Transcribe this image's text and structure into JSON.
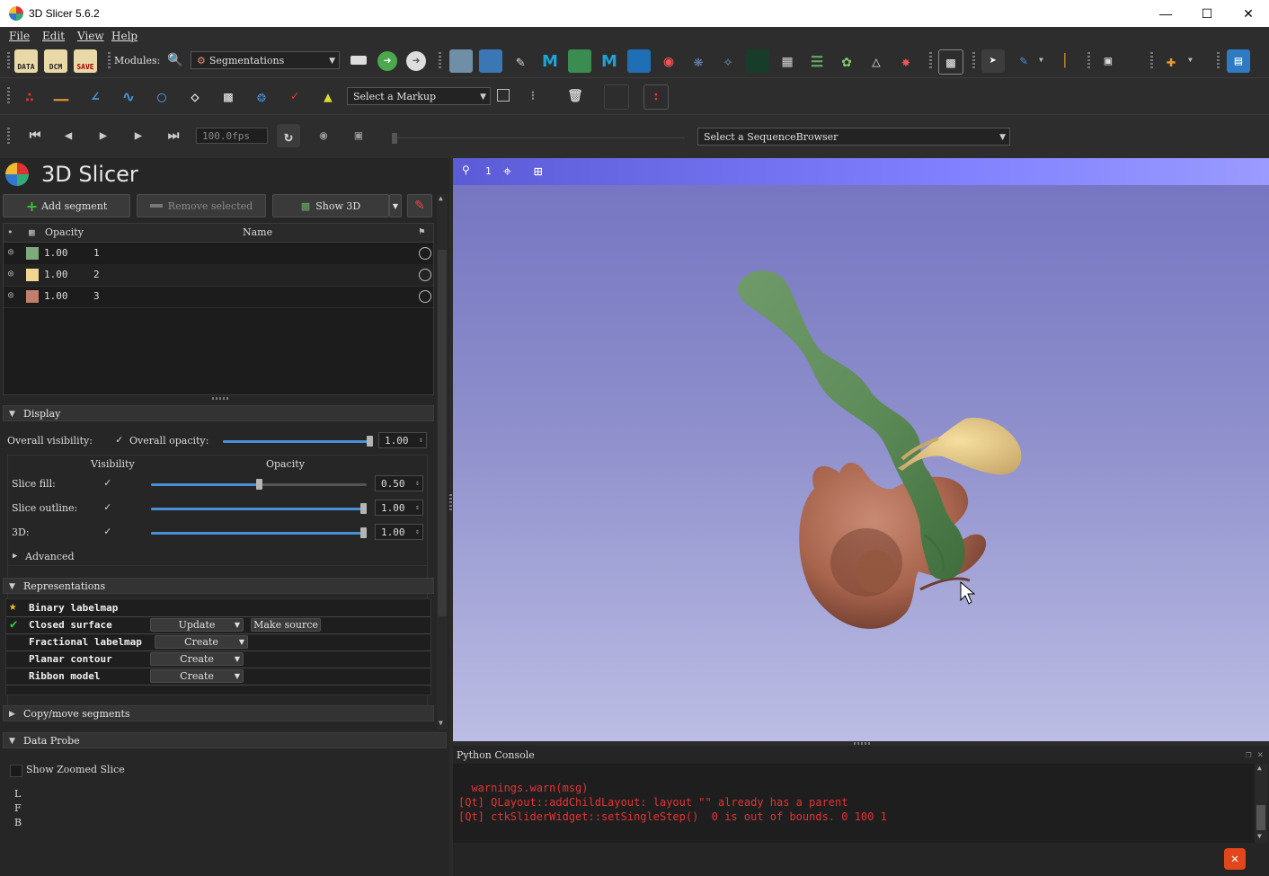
{
  "window": {
    "title": "3D Slicer 5.6.2",
    "minimize": "—",
    "maximize": "☐",
    "close": "✕"
  },
  "menu": [
    "File",
    "Edit",
    "View",
    "Help"
  ],
  "toolbar1": {
    "data_label": "DATA",
    "dcm_label": "DCM",
    "save_label": "SAVE",
    "modules_label": "Modules:",
    "module_selected": "Segmentations"
  },
  "toolbar2": {
    "markup_selector": "Select a Markup"
  },
  "toolbar3": {
    "fps": "100.0fps",
    "sequence_browser": "Select a SequenceBrowser"
  },
  "panel": {
    "logo_title": "3D Slicer",
    "add_segment": "Add segment",
    "remove_selected": "Remove selected",
    "show_3d": "Show 3D",
    "table_headers": {
      "opacity": "Opacity",
      "name": "Name"
    },
    "segments": [
      {
        "opacity": "1.00",
        "name": "1",
        "color": "#7ea97a"
      },
      {
        "opacity": "1.00",
        "name": "2",
        "color": "#f1d591"
      },
      {
        "opacity": "1.00",
        "name": "3",
        "color": "#c1806c"
      }
    ],
    "display": {
      "header": "Display",
      "overall_visibility": "Overall visibility:",
      "overall_opacity": "Overall opacity:",
      "overall_opacity_value": "1.00",
      "col_visibility": "Visibility",
      "col_opacity": "Opacity",
      "rows": [
        {
          "label": "Slice fill:",
          "value": "0.50",
          "fraction": 0.5
        },
        {
          "label": "Slice outline:",
          "value": "1.00",
          "fraction": 1.0
        },
        {
          "label": "3D:",
          "value": "1.00",
          "fraction": 1.0
        }
      ],
      "advanced": "Advanced"
    },
    "representations": {
      "header": "Representations",
      "rows": [
        {
          "name": "Binary labelmap",
          "status": "source",
          "button": "",
          "extra": ""
        },
        {
          "name": "Closed surface",
          "status": "present",
          "button": "Update",
          "extra": "Make source"
        },
        {
          "name": "Fractional labelmap",
          "status": "",
          "button": "Create",
          "extra": ""
        },
        {
          "name": "Planar contour",
          "status": "",
          "button": "Create",
          "extra": ""
        },
        {
          "name": "Ribbon model",
          "status": "",
          "button": "Create",
          "extra": ""
        }
      ]
    },
    "copy_move": "Copy/move segments",
    "data_probe": {
      "header": "Data Probe",
      "show_zoomed": "Show Zoomed Slice",
      "labels": [
        "L",
        "F",
        "B"
      ]
    }
  },
  "view": {
    "layout_number": "1"
  },
  "console": {
    "title": "Python Console",
    "lines": [
      "  warnings.warn(msg)",
      "[Qt] QLayout::addChildLayout: layout \"\" already has a parent",
      "[Qt] ctkSliderWidget::setSingleStep()  0 is out of bounds. 0 100 1"
    ]
  },
  "colors": {
    "accent": "#4a90d9",
    "error": "#e53333",
    "segment1": "#7ea97a",
    "segment2": "#f1d591",
    "segment3": "#c1806c"
  }
}
